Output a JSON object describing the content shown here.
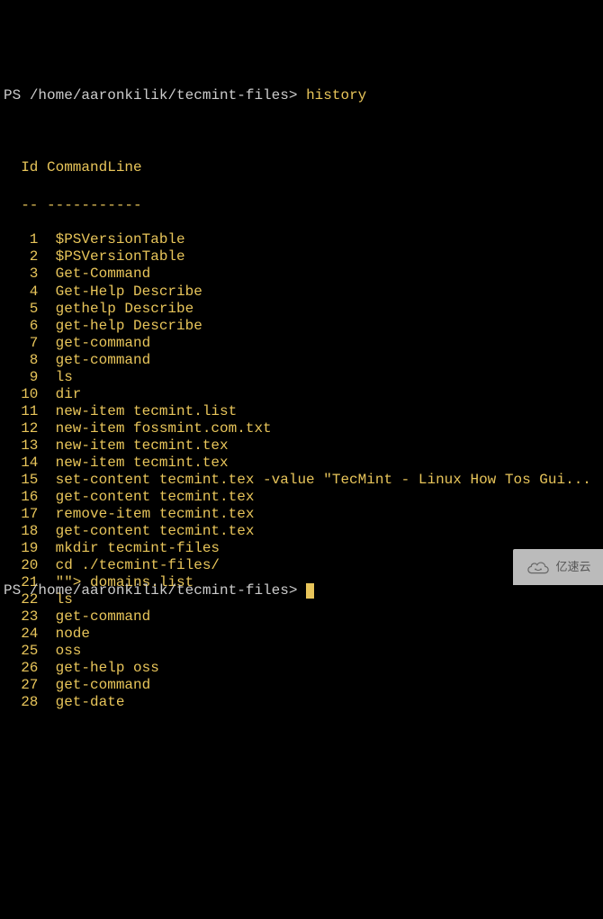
{
  "prompt1": {
    "prefix": "PS ",
    "path": "/home/aaronkilik/tecmint-files",
    "sep": "> ",
    "command": "history"
  },
  "header": {
    "id": "Id",
    "cmdline": "CommandLine",
    "id_underline": "--",
    "cmdline_underline": "-----------"
  },
  "history": [
    {
      "id": "1",
      "cmd": "$PSVersionTable"
    },
    {
      "id": "2",
      "cmd": "$PSVersionTable"
    },
    {
      "id": "3",
      "cmd": "Get-Command"
    },
    {
      "id": "4",
      "cmd": "Get-Help Describe"
    },
    {
      "id": "5",
      "cmd": "gethelp Describe"
    },
    {
      "id": "6",
      "cmd": "get-help Describe"
    },
    {
      "id": "7",
      "cmd": "get-command"
    },
    {
      "id": "8",
      "cmd": "get-command"
    },
    {
      "id": "9",
      "cmd": "ls"
    },
    {
      "id": "10",
      "cmd": "dir"
    },
    {
      "id": "11",
      "cmd": "new-item tecmint.list"
    },
    {
      "id": "12",
      "cmd": "new-item fossmint.com.txt"
    },
    {
      "id": "13",
      "cmd": "new-item tecmint.tex"
    },
    {
      "id": "14",
      "cmd": "new-item tecmint.tex"
    },
    {
      "id": "15",
      "cmd": "set-content tecmint.tex -value \"TecMint - Linux How Tos Gui..."
    },
    {
      "id": "16",
      "cmd": "get-content tecmint.tex"
    },
    {
      "id": "17",
      "cmd": "remove-item tecmint.tex"
    },
    {
      "id": "18",
      "cmd": "get-content tecmint.tex"
    },
    {
      "id": "19",
      "cmd": "mkdir tecmint-files"
    },
    {
      "id": "20",
      "cmd": "cd ./tecmint-files/"
    },
    {
      "id": "21",
      "cmd": "\"\"> domains.list"
    },
    {
      "id": "22",
      "cmd": "ls"
    },
    {
      "id": "23",
      "cmd": "get-command"
    },
    {
      "id": "24",
      "cmd": "node"
    },
    {
      "id": "25",
      "cmd": "oss"
    },
    {
      "id": "26",
      "cmd": "get-help oss"
    },
    {
      "id": "27",
      "cmd": "get-command"
    },
    {
      "id": "28",
      "cmd": "get-date"
    }
  ],
  "prompt2": {
    "prefix": "PS ",
    "path": "/home/aaronkilik/tecmint-files",
    "sep": "> "
  },
  "watermark": {
    "text": "亿速云"
  }
}
